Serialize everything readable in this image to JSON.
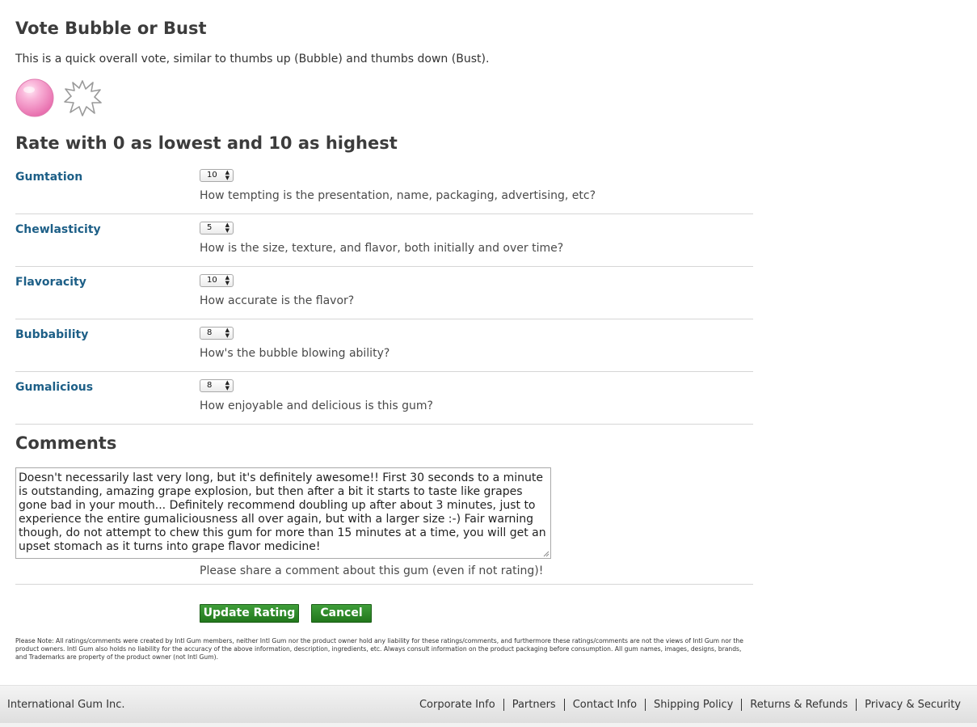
{
  "vote": {
    "heading": "Vote Bubble or Bust",
    "description": "This is a quick overall vote, similar to thumbs up (Bubble) and thumbs down (Bust).",
    "bubble_color": "#f08fc2",
    "bust_color": "#9a9a9a"
  },
  "ratings": {
    "heading": "Rate with 0 as lowest and 10 as highest",
    "items": [
      {
        "label": "Gumtation",
        "value": "10",
        "description": "How tempting is the presentation, name, packaging, advertising, etc?"
      },
      {
        "label": "Chewlasticity",
        "value": "5",
        "description": "How is the size, texture, and flavor, both initially and over time?"
      },
      {
        "label": "Flavoracity",
        "value": "10",
        "description": "How accurate is the flavor?"
      },
      {
        "label": "Bubbability",
        "value": "8",
        "description": "How's the bubble blowing ability?"
      },
      {
        "label": "Gumalicious",
        "value": "8",
        "description": "How enjoyable and delicious is this gum?"
      }
    ]
  },
  "comments": {
    "heading": "Comments",
    "text": "Doesn't necessarily last very long, but it's definitely awesome!!  First 30 seconds to a minute is outstanding, amazing grape explosion, but then after a bit it starts to taste like grapes gone bad in your mouth...  Definitely recommend doubling up after about 3 minutes, just to experience the entire gumaliciousness all over again, but with a larger size :-)  Fair warning though, do not attempt to chew this gum for more than 15 minutes at a time, you will get an upset stomach as it turns into grape flavor medicine!",
    "help": "Please share a comment about this gum (even if not rating)!"
  },
  "buttons": {
    "update": "Update Rating",
    "cancel": "Cancel",
    "color": "#2e8b29"
  },
  "disclaimer": "Please Note: All ratings/comments were created by Intl Gum members, neither Intl Gum nor the product owner hold any liability for these ratings/comments, and furthermore these ratings/comments are not the views of Intl Gum nor the product owners. Intl Gum also holds no liability for the accuracy of the above information, description, ingredients, etc. Always consult information on the product packaging before consumption. All gum names, images, designs, brands, and Trademarks are property of the product owner (not Intl Gum).",
  "footer": {
    "company": "International Gum Inc.",
    "links": [
      "Corporate Info",
      "Partners",
      "Contact Info",
      "Shipping Policy",
      "Returns & Refunds",
      "Privacy & Security"
    ]
  }
}
